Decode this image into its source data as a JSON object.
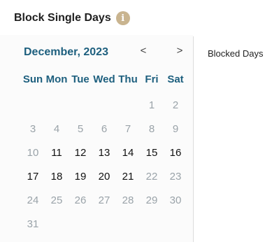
{
  "section": {
    "title": "Block Single Days",
    "info_icon": "info-icon"
  },
  "calendar": {
    "month_label": "December, 2023",
    "prev_label": "<",
    "next_label": ">",
    "weekdays": [
      "Sun",
      "Mon",
      "Tue",
      "Wed",
      "Thu",
      "Fri",
      "Sat"
    ],
    "days": [
      {
        "label": "",
        "state": "empty"
      },
      {
        "label": "",
        "state": "empty"
      },
      {
        "label": "",
        "state": "empty"
      },
      {
        "label": "",
        "state": "empty"
      },
      {
        "label": "",
        "state": "empty"
      },
      {
        "label": "1",
        "state": "disabled"
      },
      {
        "label": "2",
        "state": "disabled"
      },
      {
        "label": "3",
        "state": "disabled"
      },
      {
        "label": "4",
        "state": "disabled"
      },
      {
        "label": "5",
        "state": "disabled"
      },
      {
        "label": "6",
        "state": "disabled"
      },
      {
        "label": "7",
        "state": "disabled"
      },
      {
        "label": "8",
        "state": "disabled"
      },
      {
        "label": "9",
        "state": "disabled"
      },
      {
        "label": "10",
        "state": "disabled"
      },
      {
        "label": "11",
        "state": "enabled"
      },
      {
        "label": "12",
        "state": "enabled"
      },
      {
        "label": "13",
        "state": "enabled"
      },
      {
        "label": "14",
        "state": "enabled"
      },
      {
        "label": "15",
        "state": "enabled"
      },
      {
        "label": "16",
        "state": "enabled"
      },
      {
        "label": "17",
        "state": "enabled"
      },
      {
        "label": "18",
        "state": "enabled"
      },
      {
        "label": "19",
        "state": "enabled"
      },
      {
        "label": "20",
        "state": "enabled"
      },
      {
        "label": "21",
        "state": "enabled"
      },
      {
        "label": "22",
        "state": "disabled"
      },
      {
        "label": "23",
        "state": "disabled"
      },
      {
        "label": "24",
        "state": "disabled"
      },
      {
        "label": "25",
        "state": "disabled"
      },
      {
        "label": "26",
        "state": "disabled"
      },
      {
        "label": "27",
        "state": "disabled"
      },
      {
        "label": "28",
        "state": "disabled"
      },
      {
        "label": "29",
        "state": "disabled"
      },
      {
        "label": "30",
        "state": "disabled"
      },
      {
        "label": "31",
        "state": "disabled"
      }
    ]
  },
  "blocked": {
    "label": "Blocked Days"
  },
  "colors": {
    "accent": "#1d5f7e",
    "info_icon_bg": "#c9b48f",
    "disabled_text": "#9aa3a9",
    "enabled_text": "#111111"
  }
}
